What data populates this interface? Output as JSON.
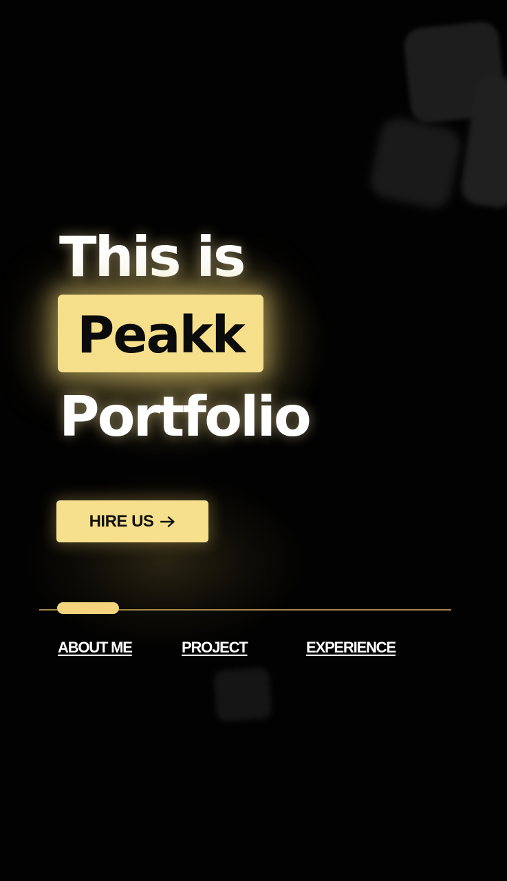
{
  "hero": {
    "line1": "This is",
    "highlight": "Peakk",
    "line3": "Portfolio"
  },
  "cta": {
    "label": "HIRE US",
    "icon": "arrow-right-icon"
  },
  "slider": {
    "progress": 0.15
  },
  "nav": {
    "items": [
      {
        "label": "ABOUT ME"
      },
      {
        "label": "PROJECT"
      },
      {
        "label": "EXPERIENCE"
      }
    ]
  },
  "colors": {
    "background": "#020202",
    "accent": "#f5df8b",
    "track": "#a8894e",
    "text": "#ffffff"
  }
}
